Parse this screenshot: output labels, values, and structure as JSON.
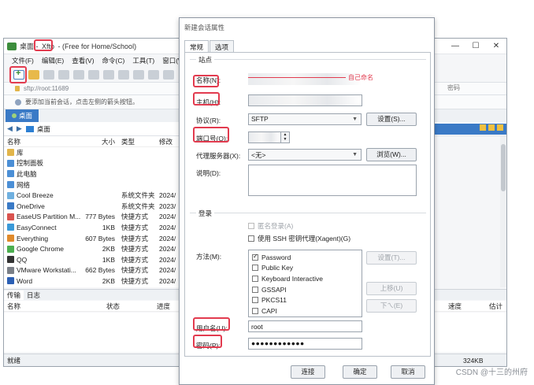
{
  "xftp": {
    "title_prefix": "桌面",
    "title_app": "Xftp",
    "title_suffix": "(Free for Home/School)",
    "window_buttons": [
      "—",
      "☐",
      "✕"
    ],
    "menu": [
      "文件(F)",
      "编辑(E)",
      "查看(V)",
      "命令(C)",
      "工具(T)",
      "窗口(W)"
    ],
    "address": "sftp://root:11689",
    "hint": "要添加当前会话，点击左侧的箭头按钮。",
    "local_tab": "桌面",
    "path": "桌面",
    "columns": [
      "名称",
      "大小",
      "类型",
      "修改"
    ],
    "files": [
      {
        "name": "库",
        "size": "",
        "type": "",
        "mod": "",
        "color": "#e2b54a"
      },
      {
        "name": "控制面板",
        "size": "",
        "type": "",
        "mod": "",
        "color": "#4b8fd6"
      },
      {
        "name": "此电脑",
        "size": "",
        "type": "",
        "mod": "",
        "color": "#4b8fd6"
      },
      {
        "name": "网络",
        "size": "",
        "type": "",
        "mod": "",
        "color": "#4b8fd6"
      },
      {
        "name": "Cool Breeze",
        "size": "",
        "type": "系统文件夹",
        "mod": "2024/",
        "color": "#6fb0e0"
      },
      {
        "name": "OneDrive",
        "size": "",
        "type": "系统文件夹",
        "mod": "2023/",
        "color": "#3a7ac6"
      },
      {
        "name": "EaseUS Partition M...",
        "size": "777 Bytes",
        "type": "快捷方式",
        "mod": "2024/",
        "color": "#d9534f"
      },
      {
        "name": "EasyConnect",
        "size": "1KB",
        "type": "快捷方式",
        "mod": "2024/",
        "color": "#3a9ad9"
      },
      {
        "name": "Everything",
        "size": "607 Bytes",
        "type": "快捷方式",
        "mod": "2024/",
        "color": "#e08a2c"
      },
      {
        "name": "Google Chrome",
        "size": "2KB",
        "type": "快捷方式",
        "mod": "2024/",
        "color": "#4caf50"
      },
      {
        "name": "QQ",
        "size": "1KB",
        "type": "快捷方式",
        "mod": "2024/",
        "color": "#333333"
      },
      {
        "name": "VMware Workstati...",
        "size": "662 Bytes",
        "type": "快捷方式",
        "mod": "2024/",
        "color": "#7a7f87"
      },
      {
        "name": "Word",
        "size": "2KB",
        "type": "快捷方式",
        "mod": "2024/",
        "color": "#2b5fb4"
      }
    ],
    "right_label": "密码",
    "transfer_tabs": [
      "传输",
      "日志"
    ],
    "transfer_columns": [
      "名称",
      "状态",
      "进度",
      "速度",
      "估计"
    ],
    "status_left": "就绪",
    "status_size": "324KB"
  },
  "dialog": {
    "title": "新建会话属性",
    "tabs": [
      "常规",
      "选项"
    ],
    "site_group": "站点",
    "name_label": "名称(N):",
    "annotation": "自己命名",
    "host_label": "主机(H):",
    "protocol_label": "协议(R):",
    "protocol_value": "SFTP",
    "settings_button": "设置(S)...",
    "port_label": "端口号(O):",
    "proxy_label": "代理服务器(X):",
    "proxy_value": "<无>",
    "browse_button": "浏览(W)...",
    "description_label": "说明(D):",
    "login_group": "登录",
    "anonymous_label": "匿名登录(A)",
    "agent_label": "使用 SSH 密钥代理(Xagent)(G)",
    "method_label": "方法(M):",
    "methods": [
      {
        "label": "Password",
        "checked": true
      },
      {
        "label": "Public Key",
        "checked": false
      },
      {
        "label": "Keyboard Interactive",
        "checked": false
      },
      {
        "label": "GSSAPI",
        "checked": false
      },
      {
        "label": "PKCS11",
        "checked": false
      },
      {
        "label": "CAPI",
        "checked": false
      }
    ],
    "method_settings_button": "设置(T)...",
    "up_button": "上移(U)",
    "down_button": "下ㄟ(E)",
    "username_label": "用户名(U):",
    "username_value": "root",
    "password_label": "密码(P):",
    "password_value": "●●●●●●●●●●●●",
    "connect_button": "连接",
    "ok_button": "确定",
    "cancel_button": "取消"
  },
  "watermark": "CSDN @十三的州府",
  "colors": {
    "highlight": "#e23b4f",
    "accent": "#3a7ac6"
  }
}
